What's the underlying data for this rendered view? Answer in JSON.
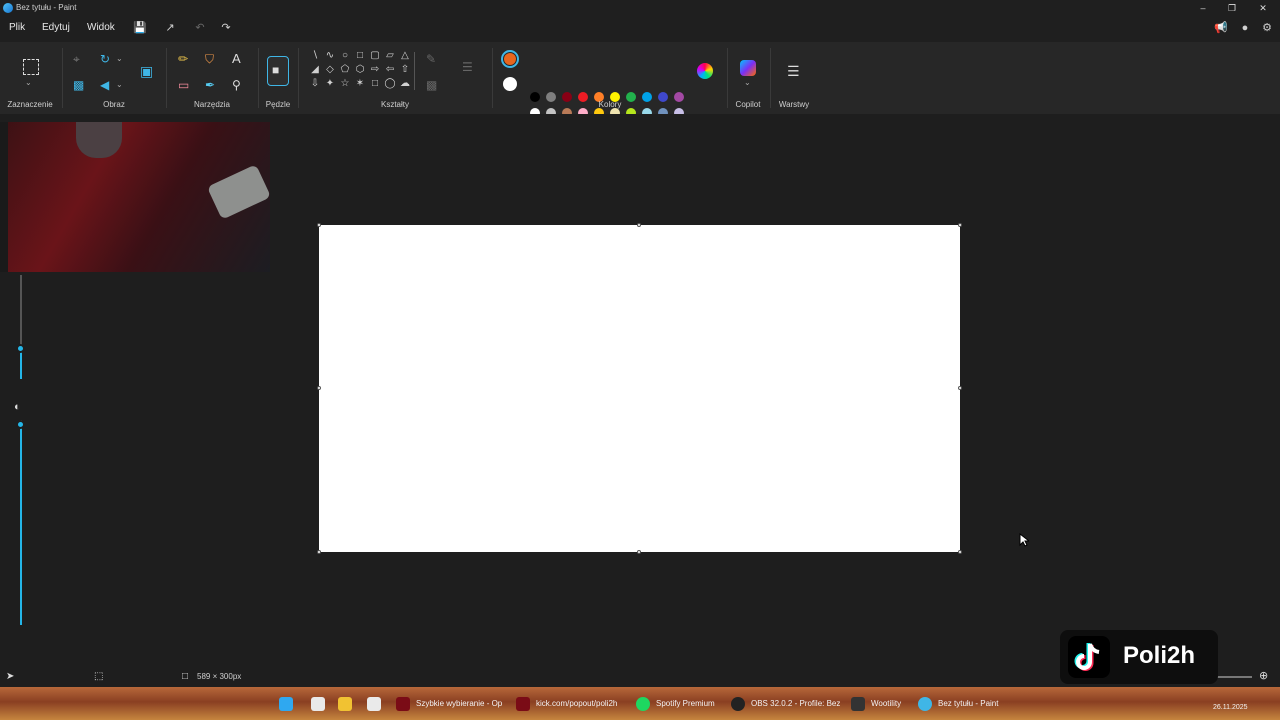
{
  "window": {
    "title": "Bez tytułu - Paint"
  },
  "menu": {
    "file": "Plik",
    "edit": "Edytuj",
    "view": "Widok"
  },
  "ribbon": {
    "groups": {
      "selection": "Zaznaczenie",
      "image": "Obraz",
      "tools": "Narzędzia",
      "brushes": "Pędzle",
      "shapes": "Kształty",
      "colors": "Kolory",
      "copilot": "Copilot",
      "layers": "Warstwy"
    },
    "primary_color": "#e8661e",
    "secondary_color": "#ffffff",
    "palette_row1": [
      "#000000",
      "#7f7f7f",
      "#880015",
      "#ed1c24",
      "#ff7f27",
      "#fff200",
      "#22b14c",
      "#00a2e8",
      "#3f48cc",
      "#a349a4"
    ],
    "palette_row2": [
      "#ffffff",
      "#c3c3c3",
      "#b97a57",
      "#ffaec9",
      "#ffc90e",
      "#efe4b0",
      "#b5e61d",
      "#99d9ea",
      "#7092be",
      "#c8bfe7"
    ]
  },
  "status": {
    "canvas_size": "589 × 300px"
  },
  "taskbar": {
    "items": [
      "Szybkie wybieranie - Op",
      "kick.com/popout/poli2h",
      "Spotify Premium",
      "OBS 32.0.2 - Profile: Bez",
      "Wootility",
      "Bez tytułu - Paint"
    ],
    "clock": "26.11.2025"
  },
  "overlay": {
    "handle": "Poli2h"
  }
}
